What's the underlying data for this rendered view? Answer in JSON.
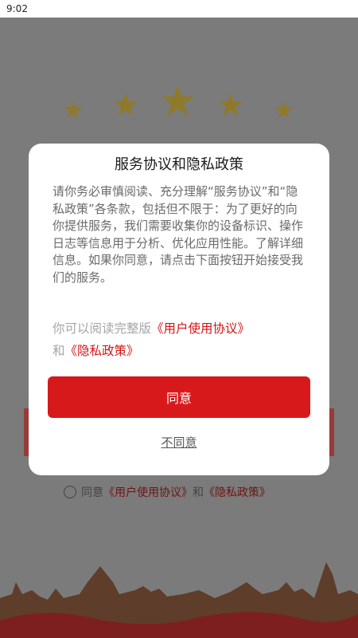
{
  "status_bar": {
    "time": "9:02"
  },
  "background": {
    "agree_prefix": "同意",
    "user_agreement": "《用户使用协议》",
    "and": "和",
    "privacy_policy": "《隐私政策》"
  },
  "dialog": {
    "title": "服务协议和隐私政策",
    "body": "请你务必审慎阅读、充分理解“服务协议”和“隐私政策”各条款，包括但不限于：为了更好的向你提供服务，我们需要收集你的设备标识、操作日志等信息用于分析、优化应用性能。了解详细信息。如果你同意，请点击下面按钮开始接受我们的服务。",
    "read_prefix": "你可以阅读完整版",
    "user_agreement_link": "《用户使用协议》",
    "and": "和",
    "privacy_link": "《隐私政策》",
    "agree_button": "同意",
    "disagree_button": "不同意"
  },
  "colors": {
    "accent": "#d8191c",
    "link": "#d41414",
    "overlay": "#7b7b7b"
  }
}
